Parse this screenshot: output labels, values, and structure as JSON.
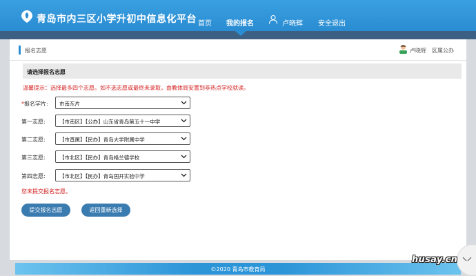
{
  "header": {
    "site_title": "青岛市内三区小学升初中信息化平台",
    "nav": {
      "home": "首页",
      "my_application": "我的报名",
      "user_name": "卢晓辉",
      "logout": "安全退出"
    }
  },
  "breadcrumb": {
    "current": "报名志愿",
    "user_name": "卢晓辉",
    "user_type": "区属公办"
  },
  "form": {
    "section_title": "请选择报名志愿",
    "hint": "温馨提示：选择最多四个志愿。如不选志愿或最终未录取，由教体局安置到非热点学校就读。",
    "rows": [
      {
        "required_mark": "*",
        "label": "报名学片:",
        "value": "市南东片"
      },
      {
        "required_mark": "",
        "label": "第一志愿:",
        "value": "【市南区】【公办】山东省青岛第五十一中学"
      },
      {
        "required_mark": "",
        "label": "第二志愿:",
        "value": "【市直属】【民办】青岛大学附属中学"
      },
      {
        "required_mark": "",
        "label": "第三志愿:",
        "value": "【市北区】【民办】青岛格兰德学校"
      },
      {
        "required_mark": "",
        "label": "第四志愿:",
        "value": "【市北区】【民办】青岛国开实验中学"
      }
    ],
    "status_warning": "您未提交报名志愿。",
    "submit_label": "提交报名志愿",
    "reset_label": "返回重新选择"
  },
  "footer": {
    "copyright": "©2020 青岛市教育局"
  },
  "watermark": "husay.cn",
  "colors": {
    "header_blue": "#2a8cd2",
    "strip_navy": "#3c5f84",
    "warning_red": "#d42020",
    "button_blue": "#3a7bb0"
  },
  "icons": {
    "logo": "location-pin-leaf-icon",
    "user": "user-outline-icon",
    "avatar": "user-avatar-icon",
    "select_arrow": "chevron-down-icon"
  }
}
